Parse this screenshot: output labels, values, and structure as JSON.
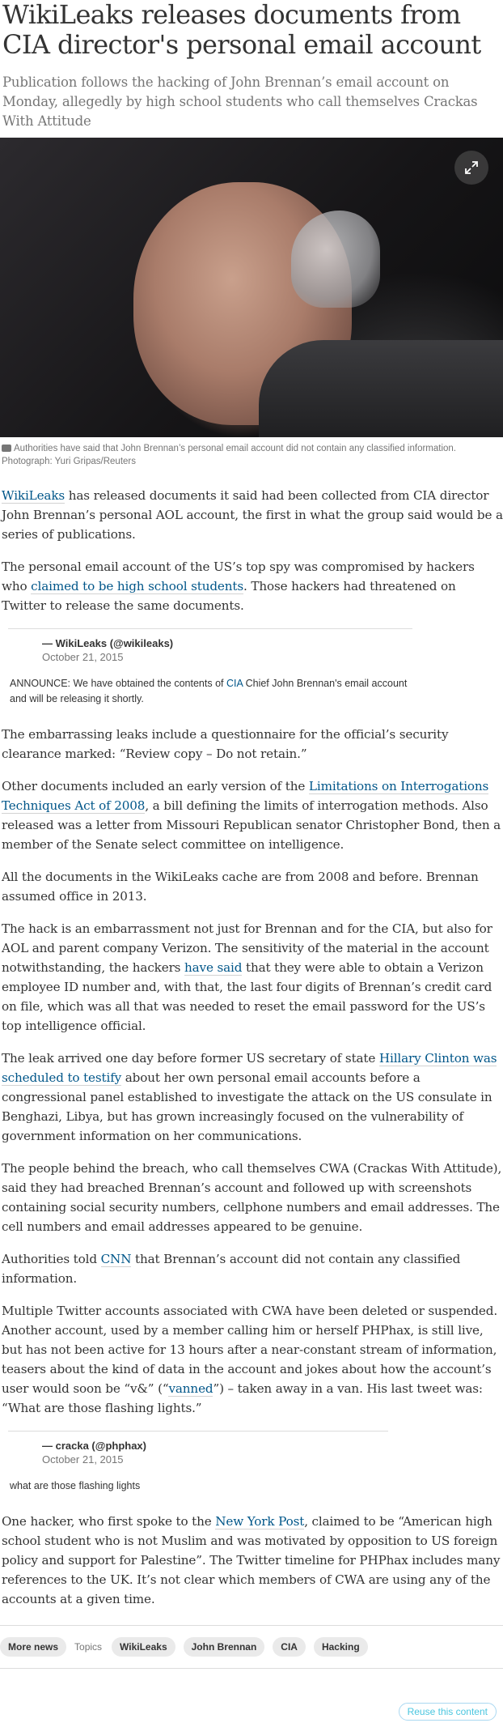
{
  "article": {
    "headline": "WikiLeaks releases documents from CIA director's personal email account",
    "standfirst": "Publication follows the hacking of John Brennan’s email account on Monday, allegedly by high school students who call themselves Crackas With Attitude",
    "image_caption": "Authorities have said that John Brennan’s personal email account did not contain any classified information. Photograph: Yuri Gripas/Reuters"
  },
  "p1": {
    "link": "WikiLeaks",
    "rest": " has released documents it said had been collected from CIA director John Brennan’s personal AOL account, the first in what the group said would be a series of publications."
  },
  "p2": {
    "pre": "The personal email account of the US’s top spy was compromised by hackers who ",
    "link": "claimed to be high school students",
    "post": ". Those hackers had threatened on Twitter to release the same documents."
  },
  "tweet1": {
    "author": "— WikiLeaks (@wikileaks)",
    "date": "October 21, 2015",
    "pre": "ANNOUNCE: We have obtained the contents of ",
    "link": "CIA",
    "post": " Chief John Brennan's email account and will be releasing it shortly."
  },
  "p3": "The embarrassing leaks include a questionnaire for the official’s security clearance marked: “Review copy – Do not retain.”",
  "p4": {
    "pre": "Other documents included an early version of the ",
    "link": "Limitations on Interrogations Techniques Act of 2008",
    "post": ", a bill defining the limits of interrogation methods. Also released was a letter from Missouri Republican senator Christopher Bond, then a member of the Senate select committee on intelligence."
  },
  "p5": "All the documents in the WikiLeaks cache are from 2008 and before. Brennan assumed office in 2013.",
  "p6": {
    "pre": "The hack is an embarrassment not just for Brennan and for the CIA, but also for AOL and parent company Verizon. The sensitivity of the material in the account notwithstanding, the hackers ",
    "link": "have said",
    "post": " that they were able to obtain a Verizon employee ID number and, with that, the last four digits of Brennan’s credit card on file, which was all that was needed to reset the email password for the US’s top intelligence official."
  },
  "p7": {
    "pre": "The leak arrived one day before former US secretary of state ",
    "link": "Hillary Clinton was scheduled to testify",
    "post": " about her own personal email accounts before a congressional panel established to investigate the attack on the US consulate in Benghazi, Libya, but has grown increasingly focused on the vulnerability of government information on her communications."
  },
  "p8": "The people behind the breach, who call themselves CWA (Crackas With Attitude), said they had breached Brennan’s account and followed up with screenshots containing social security numbers, cellphone numbers and email addresses. The cell numbers and email addresses appeared to be genuine.",
  "p9": {
    "pre": "Authorities told ",
    "link": "CNN",
    "post": " that Brennan’s account did not contain any classified information."
  },
  "p10": {
    "pre": "Multiple Twitter accounts associated with CWA have been deleted or suspended. Another account, used by a member calling him or herself PHPhax, is still live, but has not been active for 13 hours after a near-constant stream of information, teasers about the kind of data in the account and jokes about how the account’s user would soon be “v&” (“",
    "link": "vanned",
    "post": "”) – taken away in a van. His last tweet was: “What are those flashing lights.”"
  },
  "tweet2": {
    "author": "— cracka (@phphax)",
    "date": "October 21, 2015",
    "text": "what are those flashing lights"
  },
  "p11": {
    "pre": "One hacker, who first spoke to the ",
    "link": "New York Post",
    "post": ", claimed to be “American high school student who is not Muslim and was motivated by opposition to US foreign policy and support for Palestine”. The Twitter timeline for PHPhax includes many references to the UK. It’s not clear which members of CWA are using any of the accounts at a given time."
  },
  "footer": {
    "more_news": "More news",
    "topics_label": "Topics",
    "tags": [
      "WikiLeaks",
      "John Brennan",
      "CIA",
      "Hacking"
    ],
    "reuse": "Reuse this content"
  },
  "colors": {
    "link": "#005689",
    "text": "#333333",
    "muted": "#767676",
    "reuse": "#4bc6df"
  }
}
